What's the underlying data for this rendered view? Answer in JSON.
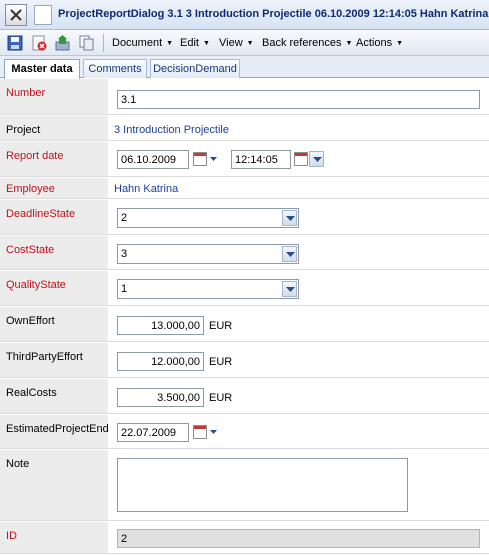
{
  "window": {
    "title": "ProjectReportDialog 3.1 3 Introduction Projectile 06.10.2009 12:14:05 Hahn Katrina"
  },
  "toolbar": {
    "icons": [
      "save-icon",
      "delete-icon",
      "export-icon",
      "copy-icon"
    ],
    "menus": [
      {
        "label": "Document"
      },
      {
        "label": "Edit"
      },
      {
        "label": "View"
      },
      {
        "label": "Back references"
      },
      {
        "label": "Actions"
      }
    ]
  },
  "tabs": [
    {
      "label": "Master data",
      "active": true
    },
    {
      "label": "Comments",
      "active": false
    },
    {
      "label": "DecisionDemand",
      "active": false
    }
  ],
  "form": {
    "number": {
      "label": "Number",
      "value": "3.1"
    },
    "project": {
      "label": "Project",
      "value": "3 Introduction Projectile"
    },
    "report_date": {
      "label": "Report date",
      "date": "06.10.2009",
      "time": "12:14:05"
    },
    "employee": {
      "label": "Employee",
      "value": "Hahn Katrina"
    },
    "deadline_state": {
      "label": "DeadlineState",
      "value": "2"
    },
    "cost_state": {
      "label": "CostState",
      "value": "3"
    },
    "quality_state": {
      "label": "QualityState",
      "value": "1"
    },
    "own_effort": {
      "label": "OwnEffort",
      "value": "13.000,00",
      "unit": "EUR"
    },
    "third_party_effort": {
      "label": "ThirdPartyEffort",
      "value": "12.000,00",
      "unit": "EUR"
    },
    "real_costs": {
      "label": "RealCosts",
      "value": "3.500,00",
      "unit": "EUR"
    },
    "estimated_project_end": {
      "label": "EstimatedProjectEnd",
      "value": "22.07.2009"
    },
    "note": {
      "label": "Note",
      "value": ""
    },
    "id": {
      "label": "ID",
      "value": "2"
    }
  },
  "colors": {
    "required_label": "#c0111b",
    "link": "#1b3f9a",
    "label_bg": "#ececec",
    "title_text": "#0f2a6e"
  }
}
